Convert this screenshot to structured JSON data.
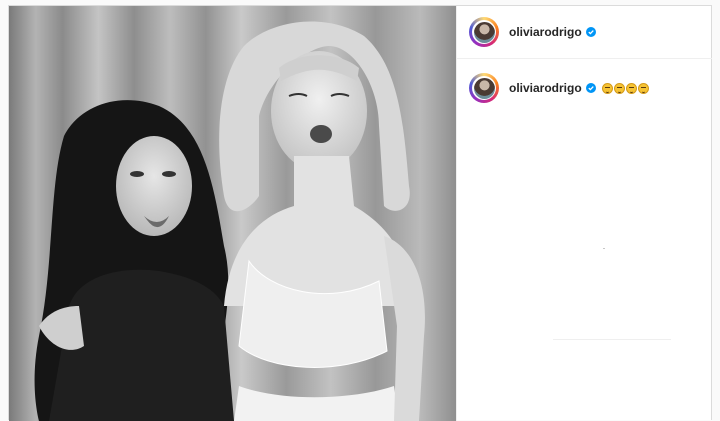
{
  "post": {
    "username": "oliviarodrigo",
    "caption_username": "oliviarodrigo",
    "caption_emojis": [
      "emoji-face",
      "emoji-face",
      "emoji-face",
      "emoji-face"
    ],
    "verified": true
  },
  "photo": {
    "description_icon": "photo-booth-image"
  },
  "colors": {
    "verified_blue": "#0095f6",
    "text": "#262626",
    "border": "#dbdbdb"
  }
}
